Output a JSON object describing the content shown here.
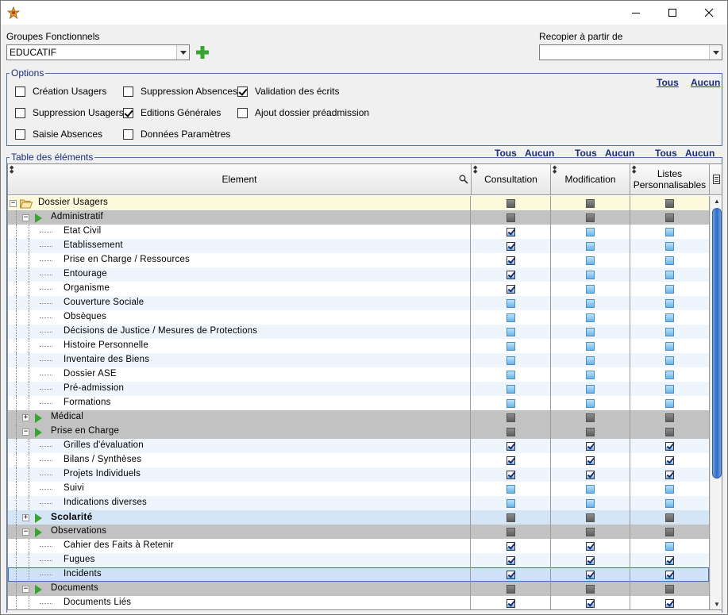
{
  "window": {
    "minimize": "—",
    "maximize": "☐",
    "close": "✕"
  },
  "groupes": {
    "label": "Groupes Fonctionnels",
    "value": "EDUCATIF"
  },
  "recopier": {
    "label": "Recopier à partir de",
    "value": ""
  },
  "options": {
    "title": "Options",
    "tous": "Tous",
    "aucun": "Aucun",
    "items": [
      {
        "label": "Création Usagers",
        "checked": false
      },
      {
        "label": "Suppression Absences",
        "checked": false
      },
      {
        "label": "Validation des écrits",
        "checked": true
      },
      {
        "label": "Suppression Usagers",
        "checked": false
      },
      {
        "label": "Editions Générales",
        "checked": true
      },
      {
        "label": "Ajout dossier préadmission",
        "checked": false
      },
      {
        "label": "Saisie Absences",
        "checked": false
      },
      {
        "label": "Données Paramètres",
        "checked": false
      }
    ]
  },
  "table": {
    "title": "Table des éléments",
    "tous": "Tous",
    "aucun": "Aucun",
    "headers": {
      "element": "Element",
      "consultation": "Consultation",
      "modification": "Modification",
      "listes_line1": "Listes",
      "listes_line2": "Personnalisables"
    },
    "rows": [
      {
        "label": "Dossier Usagers",
        "level": 0,
        "kind": "root",
        "cells": [
          "g",
          "g",
          "g"
        ]
      },
      {
        "label": "Administratif",
        "level": 1,
        "kind": "group",
        "expanded": true,
        "cells": [
          "g",
          "g",
          "g"
        ]
      },
      {
        "label": "Etat Civil",
        "level": 2,
        "kind": "leaf",
        "cells": [
          "c",
          "b",
          "b"
        ]
      },
      {
        "label": "Etablissement",
        "level": 2,
        "kind": "leaf",
        "cells": [
          "c",
          "b",
          "b"
        ]
      },
      {
        "label": "Prise en Charge / Ressources",
        "level": 2,
        "kind": "leaf",
        "cells": [
          "c",
          "b",
          "b"
        ]
      },
      {
        "label": "Entourage",
        "level": 2,
        "kind": "leaf",
        "cells": [
          "c",
          "b",
          "b"
        ]
      },
      {
        "label": "Organisme",
        "level": 2,
        "kind": "leaf",
        "cells": [
          "c",
          "b",
          "b"
        ]
      },
      {
        "label": "Couverture Sociale",
        "level": 2,
        "kind": "leaf",
        "cells": [
          "b",
          "b",
          "b"
        ]
      },
      {
        "label": "Obsèques",
        "level": 2,
        "kind": "leaf",
        "cells": [
          "b",
          "b",
          "b"
        ]
      },
      {
        "label": "Décisions de Justice / Mesures de Protections",
        "level": 2,
        "kind": "leaf",
        "cells": [
          "b",
          "b",
          "b"
        ]
      },
      {
        "label": "Histoire Personnelle",
        "level": 2,
        "kind": "leaf",
        "cells": [
          "b",
          "b",
          "b"
        ]
      },
      {
        "label": "Inventaire des Biens",
        "level": 2,
        "kind": "leaf",
        "cells": [
          "b",
          "b",
          "b"
        ]
      },
      {
        "label": "Dossier ASE",
        "level": 2,
        "kind": "leaf",
        "cells": [
          "b",
          "b",
          "b"
        ]
      },
      {
        "label": "Pré-admission",
        "level": 2,
        "kind": "leaf",
        "cells": [
          "b",
          "b",
          "b"
        ]
      },
      {
        "label": "Formations",
        "level": 2,
        "kind": "leaf",
        "cells": [
          "b",
          "b",
          "b"
        ]
      },
      {
        "label": "Médical",
        "level": 1,
        "kind": "group",
        "expanded": false,
        "cells": [
          "g",
          "g",
          "g"
        ]
      },
      {
        "label": "Prise en Charge",
        "level": 1,
        "kind": "group",
        "expanded": true,
        "cells": [
          "g",
          "g",
          "g"
        ]
      },
      {
        "label": "Grilles d'évaluation",
        "level": 2,
        "kind": "leaf",
        "cells": [
          "c",
          "c",
          "c"
        ]
      },
      {
        "label": "Bilans / Synthèses",
        "level": 2,
        "kind": "leaf",
        "cells": [
          "c",
          "c",
          "c"
        ]
      },
      {
        "label": "Projets Individuels",
        "level": 2,
        "kind": "leaf",
        "cells": [
          "c",
          "c",
          "c"
        ]
      },
      {
        "label": "Suivi",
        "level": 2,
        "kind": "leaf",
        "cells": [
          "b",
          "b",
          "b"
        ]
      },
      {
        "label": "Indications diverses",
        "level": 2,
        "kind": "leaf",
        "cells": [
          "b",
          "b",
          "b"
        ]
      },
      {
        "label": "Scolarité",
        "level": 1,
        "kind": "group-hot",
        "expanded": false,
        "cells": [
          "g",
          "g",
          "g"
        ]
      },
      {
        "label": "Observations",
        "level": 1,
        "kind": "group",
        "expanded": true,
        "cells": [
          "g",
          "g",
          "g"
        ]
      },
      {
        "label": "Cahier des Faits à Retenir",
        "level": 2,
        "kind": "leaf",
        "cells": [
          "c",
          "c",
          "b"
        ]
      },
      {
        "label": "Fugues",
        "level": 2,
        "kind": "leaf",
        "cells": [
          "c",
          "c",
          "c"
        ]
      },
      {
        "label": "Incidents",
        "level": 2,
        "kind": "selected",
        "cells": [
          "c",
          "c",
          "c"
        ]
      },
      {
        "label": "Documents",
        "level": 1,
        "kind": "group",
        "expanded": true,
        "cells": [
          "g",
          "g",
          "g"
        ]
      },
      {
        "label": "Documents Liés",
        "level": 2,
        "kind": "leaf",
        "cells": [
          "c",
          "c",
          "c"
        ]
      }
    ]
  },
  "colors": {
    "accent": "#1a2d7a",
    "group_row": "#c2c2c2",
    "root_row": "#fbf8dc",
    "alt_row": "#eef5fc",
    "selected_row": "#cfe2f7",
    "hot_row": "#d4e6f6",
    "plus_green": "#3aa332"
  }
}
